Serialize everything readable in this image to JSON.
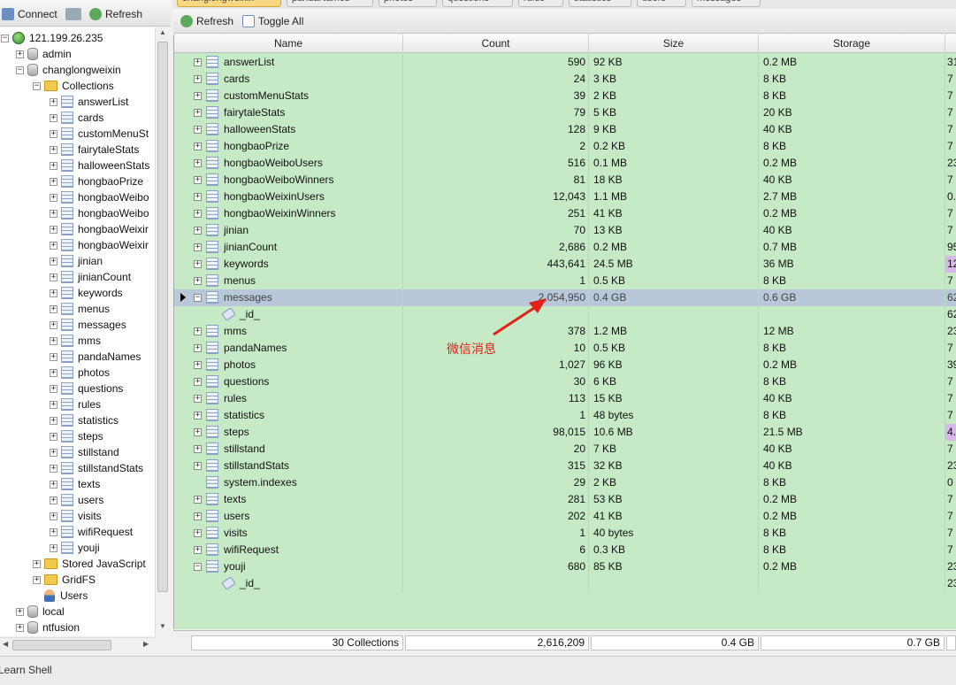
{
  "toolbar_left": {
    "connect": "Connect",
    "refresh": "Refresh"
  },
  "toolbar_right": {
    "refresh": "Refresh",
    "toggle_all": "Toggle All"
  },
  "tabs": [
    "changlongweixin",
    "pandaNames",
    "photos",
    "questions",
    "rules",
    "statistics",
    "users",
    "messages"
  ],
  "tree": {
    "server": "121.199.26.235",
    "dbs_top": [
      "admin",
      "changlongweixin"
    ],
    "collections_label": "Collections",
    "collections": [
      "answerList",
      "cards",
      "customMenuSt",
      "fairytaleStats",
      "halloweenStats",
      "hongbaoPrize",
      "hongbaoWeibo",
      "hongbaoWeibo",
      "hongbaoWeixir",
      "hongbaoWeixir",
      "jinian",
      "jinianCount",
      "keywords",
      "menus",
      "messages",
      "mms",
      "pandaNames",
      "photos",
      "questions",
      "rules",
      "statistics",
      "steps",
      "stillstand",
      "stillstandStats",
      "texts",
      "users",
      "visits",
      "wifiRequest",
      "youji"
    ],
    "stored_js": "Stored JavaScript",
    "gridfs": "GridFS",
    "users": "Users",
    "dbs_bottom": [
      "local",
      "ntfusion"
    ]
  },
  "grid": {
    "columns": [
      "Name",
      "Count",
      "Size",
      "Storage"
    ],
    "rows": [
      {
        "name": "answerList",
        "count": "590",
        "size": "92 KB",
        "storage": "0.2 MB",
        "extra": "31"
      },
      {
        "name": "cards",
        "count": "24",
        "size": "3 KB",
        "storage": "8 KB",
        "extra": "7"
      },
      {
        "name": "customMenuStats",
        "count": "39",
        "size": "2 KB",
        "storage": "8 KB",
        "extra": "7"
      },
      {
        "name": "fairytaleStats",
        "count": "79",
        "size": "5 KB",
        "storage": "20 KB",
        "extra": "7"
      },
      {
        "name": "halloweenStats",
        "count": "128",
        "size": "9 KB",
        "storage": "40 KB",
        "extra": "7"
      },
      {
        "name": "hongbaoPrize",
        "count": "2",
        "size": "0.2 KB",
        "storage": "8 KB",
        "extra": "7"
      },
      {
        "name": "hongbaoWeiboUsers",
        "count": "516",
        "size": "0.1 MB",
        "storage": "0.2 MB",
        "extra": "23"
      },
      {
        "name": "hongbaoWeiboWinners",
        "count": "81",
        "size": "18 KB",
        "storage": "40 KB",
        "extra": "7"
      },
      {
        "name": "hongbaoWeixinUsers",
        "count": "12,043",
        "size": "1.1 MB",
        "storage": "2.7 MB",
        "extra": "0."
      },
      {
        "name": "hongbaoWeixinWinners",
        "count": "251",
        "size": "41 KB",
        "storage": "0.2 MB",
        "extra": "7"
      },
      {
        "name": "jinian",
        "count": "70",
        "size": "13 KB",
        "storage": "40 KB",
        "extra": "7"
      },
      {
        "name": "jinianCount",
        "count": "2,686",
        "size": "0.2 MB",
        "storage": "0.7 MB",
        "extra": "95"
      },
      {
        "name": "keywords",
        "count": "443,641",
        "size": "24.5 MB",
        "storage": "36 MB",
        "extra": "12",
        "hl": true
      },
      {
        "name": "menus",
        "count": "1",
        "size": "0.5 KB",
        "storage": "8 KB",
        "extra": "7"
      },
      {
        "name": "messages",
        "count": "2,054,950",
        "size": "0.4 GB",
        "storage": "0.6 GB",
        "extra": "62",
        "sel": true,
        "open": true
      },
      {
        "name": "_id_",
        "index": true,
        "extra": "62"
      },
      {
        "name": "mms",
        "count": "378",
        "size": "1.2 MB",
        "storage": "12 MB",
        "extra": "23"
      },
      {
        "name": "pandaNames",
        "count": "10",
        "size": "0.5 KB",
        "storage": "8 KB",
        "extra": "7"
      },
      {
        "name": "photos",
        "count": "1,027",
        "size": "96 KB",
        "storage": "0.2 MB",
        "extra": "39"
      },
      {
        "name": "questions",
        "count": "30",
        "size": "6 KB",
        "storage": "8 KB",
        "extra": "7"
      },
      {
        "name": "rules",
        "count": "113",
        "size": "15 KB",
        "storage": "40 KB",
        "extra": "7"
      },
      {
        "name": "statistics",
        "count": "1",
        "size": "48 bytes",
        "storage": "8 KB",
        "extra": "7"
      },
      {
        "name": "steps",
        "count": "98,015",
        "size": "10.6 MB",
        "storage": "21.5 MB",
        "extra": "4.",
        "hl": true
      },
      {
        "name": "stillstand",
        "count": "20",
        "size": "7 KB",
        "storage": "40 KB",
        "extra": "7"
      },
      {
        "name": "stillstandStats",
        "count": "315",
        "size": "32 KB",
        "storage": "40 KB",
        "extra": "23"
      },
      {
        "name": "system.indexes",
        "count": "29",
        "size": "2 KB",
        "storage": "8 KB",
        "extra": "0",
        "noexp": true
      },
      {
        "name": "texts",
        "count": "281",
        "size": "53 KB",
        "storage": "0.2 MB",
        "extra": "7"
      },
      {
        "name": "users",
        "count": "202",
        "size": "41 KB",
        "storage": "0.2 MB",
        "extra": "7"
      },
      {
        "name": "visits",
        "count": "1",
        "size": "40 bytes",
        "storage": "8 KB",
        "extra": "7"
      },
      {
        "name": "wifiRequest",
        "count": "6",
        "size": "0.3 KB",
        "storage": "8 KB",
        "extra": "7"
      },
      {
        "name": "youji",
        "count": "680",
        "size": "85 KB",
        "storage": "0.2 MB",
        "extra": "23",
        "open": true
      },
      {
        "name": "_id_",
        "index": true,
        "extra": "23"
      }
    ]
  },
  "footer": {
    "collections": "30 Collections",
    "count": "2,616,209",
    "size": "0.4 GB",
    "storage": "0.7 GB"
  },
  "annotation": "微信消息",
  "status": "Learn Shell",
  "colors": {
    "row_bg": "#c6eac6",
    "selected": "#b8c7da",
    "annotation": "#e0201b"
  }
}
